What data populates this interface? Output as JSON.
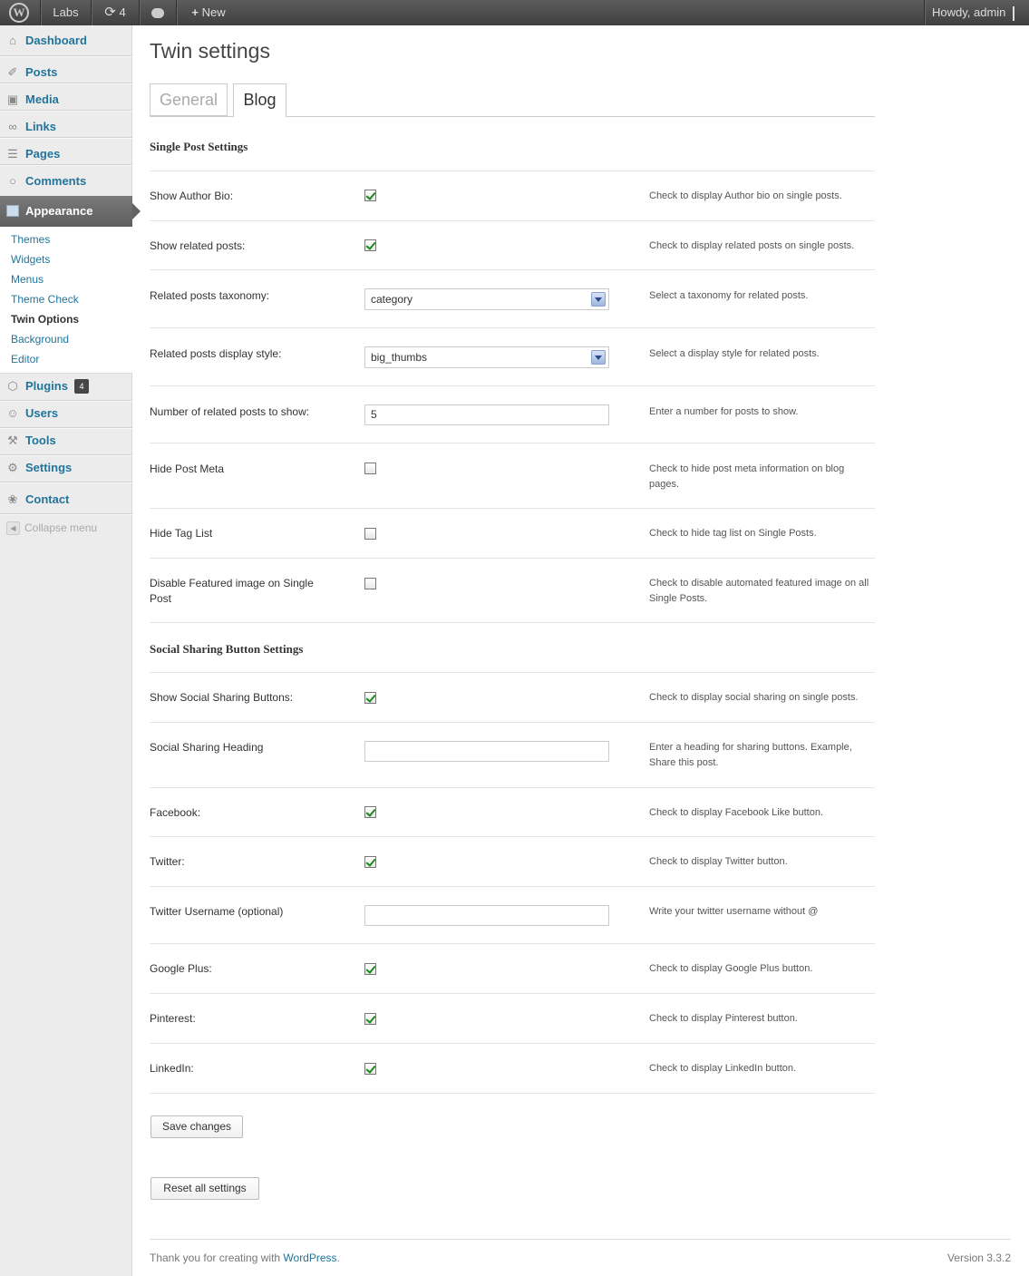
{
  "adminbar": {
    "site_name": "Labs",
    "updates_count": "4",
    "new_label": "New",
    "howdy": "Howdy, admin"
  },
  "sidebar": {
    "items": [
      {
        "label": "Dashboard",
        "icon": "home-icon"
      },
      {
        "label": "Posts",
        "icon": "pin-icon"
      },
      {
        "label": "Media",
        "icon": "media-icon"
      },
      {
        "label": "Links",
        "icon": "link-icon"
      },
      {
        "label": "Pages",
        "icon": "page-icon"
      },
      {
        "label": "Comments",
        "icon": "comment-icon"
      },
      {
        "label": "Appearance",
        "icon": "appearance-icon"
      },
      {
        "label": "Plugins",
        "icon": "plugin-icon"
      },
      {
        "label": "Users",
        "icon": "users-icon"
      },
      {
        "label": "Tools",
        "icon": "tools-icon"
      },
      {
        "label": "Settings",
        "icon": "settings-icon"
      },
      {
        "label": "Contact",
        "icon": "contact-icon"
      }
    ],
    "submenu": [
      "Themes",
      "Widgets",
      "Menus",
      "Theme Check",
      "Twin Options",
      "Background",
      "Editor"
    ],
    "plugins_badge": "4",
    "collapse_label": "Collapse menu"
  },
  "page": {
    "title": "Twin settings",
    "tabs": [
      "General",
      "Blog"
    ]
  },
  "sections": {
    "single_post": "Single Post Settings",
    "social": "Social Sharing Button Settings"
  },
  "rows": [
    {
      "label": "Show Author Bio:",
      "desc": "Check to display Author bio on single posts.",
      "checked": true
    },
    {
      "label": "Show related posts:",
      "desc": "Check to display related posts on single posts.",
      "checked": true
    },
    {
      "label": "Related posts taxonomy:",
      "desc": "Select a taxonomy for related posts.",
      "value": "category"
    },
    {
      "label": "Related posts display style:",
      "desc": "Select a display style for related posts.",
      "value": "big_thumbs"
    },
    {
      "label": "Number of related posts to show:",
      "desc": "Enter a number for posts to show.",
      "value": "5"
    },
    {
      "label": "Hide Post Meta",
      "desc": "Check to hide post meta information on blog pages.",
      "checked": false
    },
    {
      "label": "Hide Tag List",
      "desc": "Check to hide tag list on Single Posts.",
      "checked": false
    },
    {
      "label": "Disable Featured image on Single Post",
      "desc": "Check to disable automated featured image on all Single Posts.",
      "checked": false
    },
    {
      "label": "Show Social Sharing Buttons:",
      "desc": "Check to display social sharing on single posts.",
      "checked": true
    },
    {
      "label": "Social Sharing Heading",
      "desc": "Enter a heading for sharing buttons. Example, Share this post.",
      "value": ""
    },
    {
      "label": "Facebook:",
      "desc": "Check to display Facebook Like button.",
      "checked": true
    },
    {
      "label": "Twitter:",
      "desc": "Check to display Twitter button.",
      "checked": true
    },
    {
      "label": "Twitter Username (optional)",
      "desc": "Write your twitter username without @",
      "value": ""
    },
    {
      "label": "Google Plus:",
      "desc": "Check to display Google Plus button.",
      "checked": true
    },
    {
      "label": "Pinterest:",
      "desc": "Check to display Pinterest button.",
      "checked": true
    },
    {
      "label": "LinkedIn:",
      "desc": "Check to display LinkedIn button.",
      "checked": true
    }
  ],
  "buttons": {
    "save": "Save changes",
    "reset": "Reset all settings"
  },
  "footer": {
    "thanks_prefix": "Thank you for creating with ",
    "thanks_link": "WordPress",
    "thanks_suffix": ".",
    "version": "Version 3.3.2"
  }
}
